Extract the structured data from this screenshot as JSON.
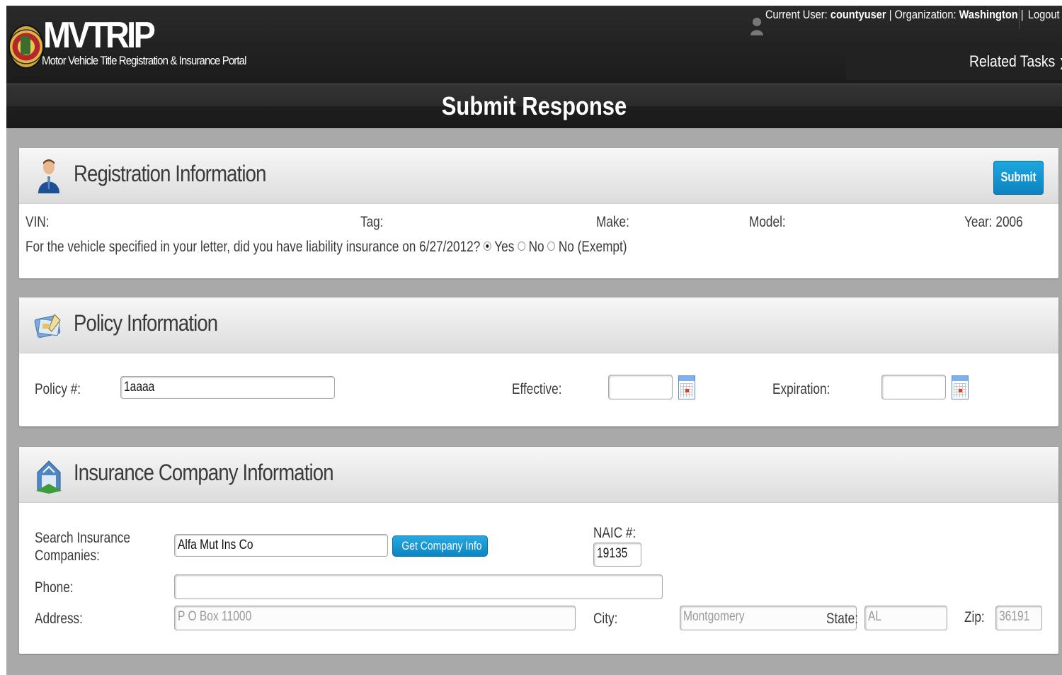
{
  "header": {
    "logo_title": "MVTRIP",
    "logo_subtitle": "Motor Vehicle Title Registration & Insurance Portal",
    "current_user_label": "Current User:",
    "current_user": "countyuser",
    "organization_label": "| Organization:",
    "organization": "Washington",
    "separator": "|",
    "logout_label": "Logout",
    "related_tasks_label": "Related Tasks",
    "related_tasks_icon": "chevron-down-icon"
  },
  "page_title": "Submit Response",
  "registration": {
    "title": "Registration Information",
    "icon": "person-icon",
    "submit_label": "Submit",
    "vin_label": "VIN:",
    "tag_label": "Tag:",
    "make_label": "Make:",
    "model_label": "Model:",
    "year_label": "Year:",
    "year_value": "2006",
    "question": "For the vehicle specified in your letter, did you have liability insurance on",
    "question_date": "6/27/2012?",
    "options": [
      {
        "label": "Yes",
        "selected": true
      },
      {
        "label": "No",
        "selected": false
      },
      {
        "label": "No (Exempt)",
        "selected": false
      }
    ]
  },
  "policy": {
    "title": "Policy Information",
    "icon": "policy-card-icon",
    "policy_label": "Policy #:",
    "policy_value": "1aaaa",
    "effective_label": "Effective:",
    "effective_value": "",
    "expiration_label": "Expiration:",
    "expiration_value": ""
  },
  "company": {
    "title": "Insurance Company Information",
    "icon": "building-icon",
    "search_label_line1": "Search Insurance",
    "search_label_line2": "Companies:",
    "search_value": "Alfa Mut Ins Co",
    "get_info_label": "Get Company Info",
    "naic_label": "NAIC #:",
    "naic_value": "19135",
    "phone_label": "Phone:",
    "phone_value": "",
    "address_label": "Address:",
    "address_value": "P O Box 11000",
    "city_label": "City:",
    "city_value": "Montgomery",
    "state_label": "State:",
    "state_value": "AL",
    "zip_label": "Zip:",
    "zip_value": "36191"
  },
  "colors": {
    "header_bg": "#1c1c1c",
    "page_bg": "#a9a9a9",
    "button_blue": "#0b83c1"
  }
}
